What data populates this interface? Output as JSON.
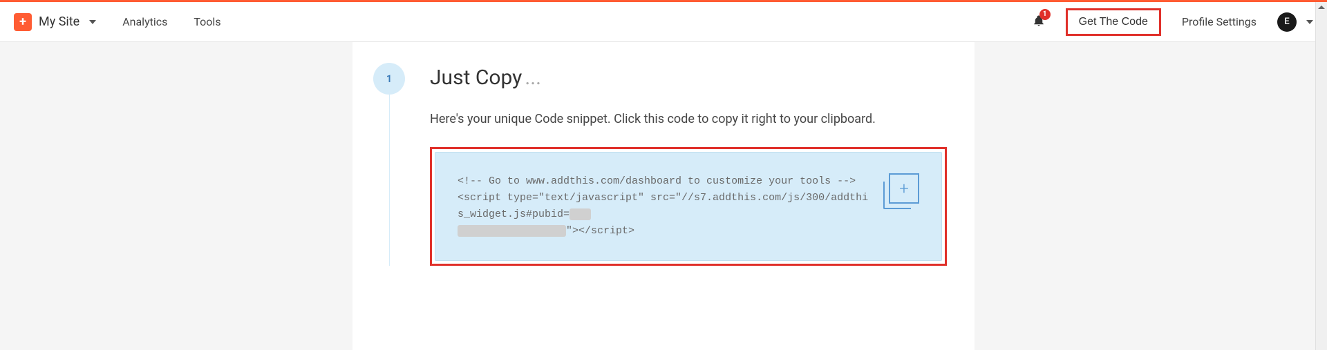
{
  "header": {
    "site_name": "My Site",
    "nav": {
      "analytics": "Analytics",
      "tools": "Tools"
    },
    "notification_count": "1",
    "get_code_label": "Get The Code",
    "profile_settings": "Profile Settings",
    "avatar_initial": "E"
  },
  "step": {
    "number": "1",
    "title": "Just Copy",
    "title_suffix": "...",
    "description": "Here's your unique Code snippet. Click this code to copy it right to your clipboard.",
    "code_line1": "<!-- Go to www.addthis.com/dashboard to customize your tools -->",
    "code_line2a": "<script type=\"text/javascript\" src=\"//s7.addthis.com/js/300/addthis_widget.js#pubid=",
    "code_line2_redacted1": "xxx",
    "code_line2_redacted2": "xxxxxxxxxxxxxxxxx",
    "code_line2c": "\"></script>"
  }
}
